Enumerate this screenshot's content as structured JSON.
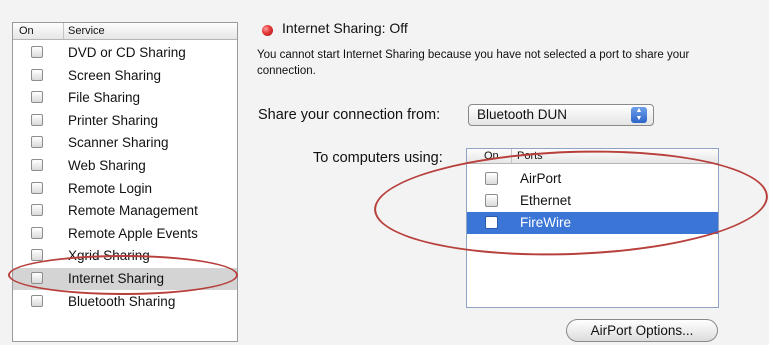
{
  "services_list": {
    "header": {
      "on": "On",
      "service": "Service"
    },
    "items": [
      {
        "label": "DVD or CD Sharing",
        "checked": false,
        "selected": false
      },
      {
        "label": "Screen Sharing",
        "checked": false,
        "selected": false
      },
      {
        "label": "File Sharing",
        "checked": false,
        "selected": false
      },
      {
        "label": "Printer Sharing",
        "checked": false,
        "selected": false
      },
      {
        "label": "Scanner Sharing",
        "checked": false,
        "selected": false
      },
      {
        "label": "Web Sharing",
        "checked": false,
        "selected": false
      },
      {
        "label": "Remote Login",
        "checked": false,
        "selected": false
      },
      {
        "label": "Remote Management",
        "checked": false,
        "selected": false
      },
      {
        "label": "Remote Apple Events",
        "checked": false,
        "selected": false
      },
      {
        "label": "Xgrid Sharing",
        "checked": false,
        "selected": false
      },
      {
        "label": "Internet Sharing",
        "checked": false,
        "selected": true
      },
      {
        "label": "Bluetooth Sharing",
        "checked": false,
        "selected": false
      }
    ]
  },
  "status": {
    "text": "Internet Sharing: Off",
    "indicator_color": "#e33434",
    "description": "You cannot start Internet Sharing because you have not selected a port to share your connection."
  },
  "share_from": {
    "label": "Share your connection from:",
    "selected_value": "Bluetooth DUN"
  },
  "to_computers": {
    "label": "To computers using:",
    "header": {
      "on": "On",
      "ports": "Ports"
    },
    "ports": [
      {
        "label": "AirPort",
        "checked": false,
        "selected": false
      },
      {
        "label": "Ethernet",
        "checked": false,
        "selected": false
      },
      {
        "label": "FireWire",
        "checked": false,
        "selected": true
      }
    ]
  },
  "airport_options_button": "AirPort Options...",
  "colors": {
    "selection_blue": "#3b76d6",
    "annotation_oval": "#b8403c"
  }
}
